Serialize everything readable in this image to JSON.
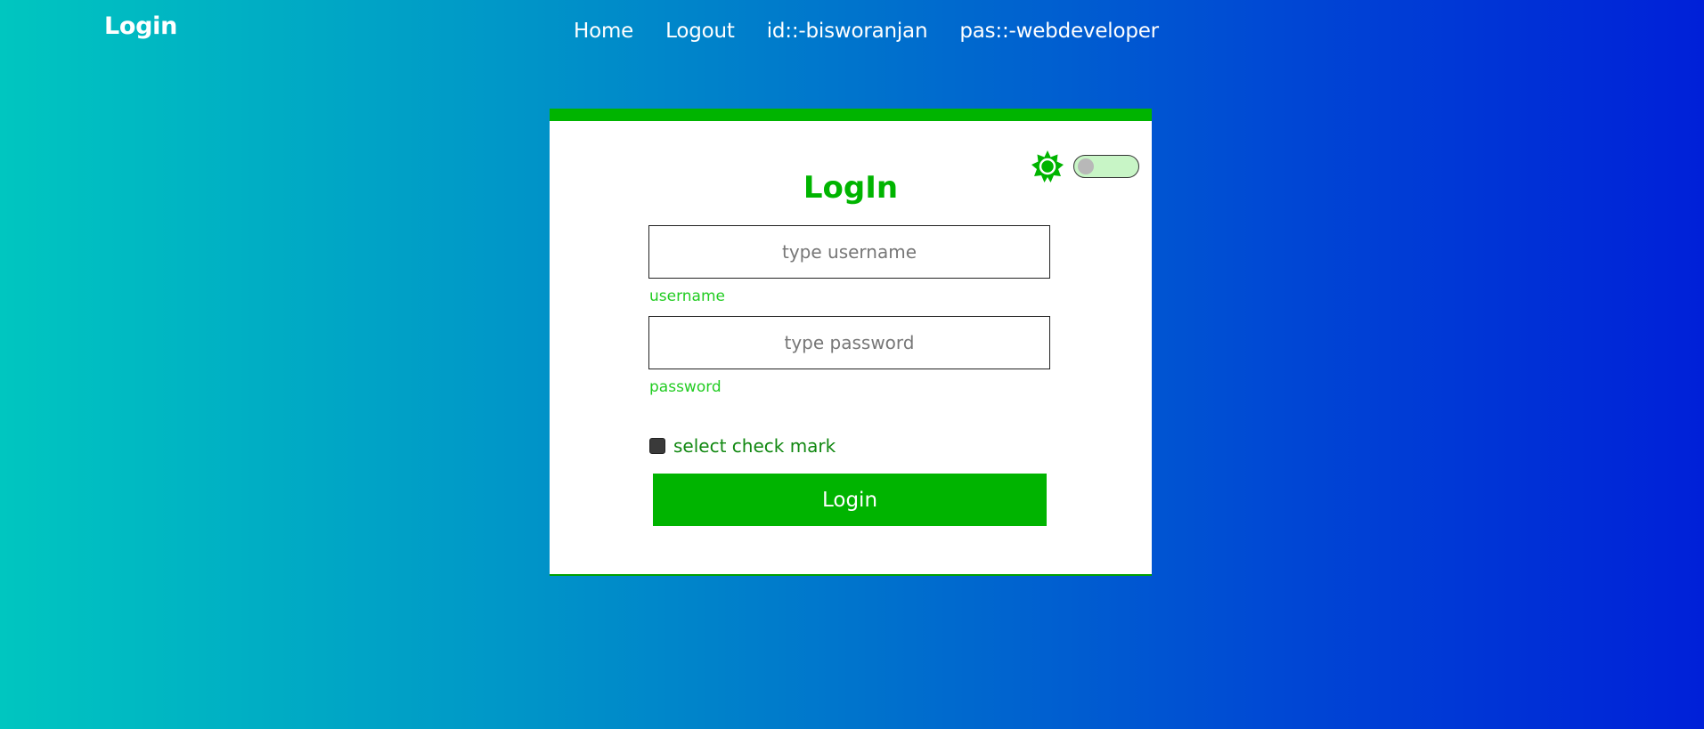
{
  "brand": "Login",
  "nav": {
    "items": [
      {
        "label": "Home"
      },
      {
        "label": "Logout"
      },
      {
        "label": "id::-bisworanjan"
      },
      {
        "label": "pas::-webdeveloper"
      }
    ]
  },
  "card": {
    "title": "LogIn",
    "theme_icon": "sun-icon",
    "theme_toggle_state": "off",
    "username": {
      "placeholder": "type username",
      "value": "",
      "label": "username"
    },
    "password": {
      "placeholder": "type password",
      "value": "",
      "label": "password"
    },
    "checkbox": {
      "label": "select check mark",
      "checked": false
    },
    "submit_label": "Login"
  },
  "colors": {
    "accent": "#00b400",
    "background_start": "#00c6c0",
    "background_end": "#0020d8"
  }
}
